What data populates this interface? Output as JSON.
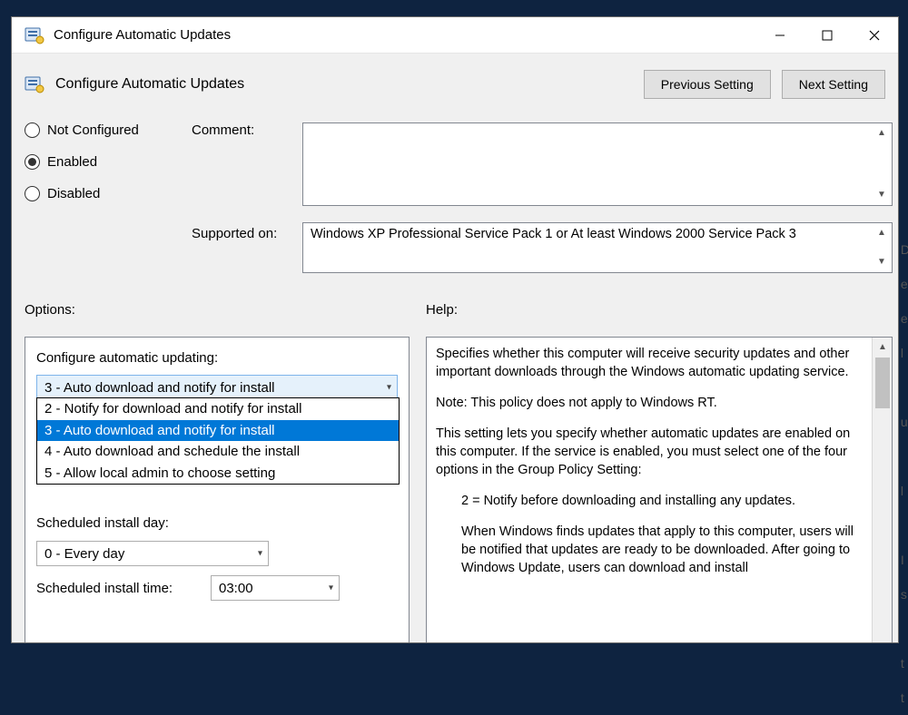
{
  "window": {
    "title": "Configure Automatic Updates",
    "header_title": "Configure Automatic Updates"
  },
  "nav": {
    "previous": "Previous Setting",
    "next": "Next Setting"
  },
  "state_radios": {
    "not_configured": "Not Configured",
    "enabled": "Enabled",
    "disabled": "Disabled",
    "selected": "enabled"
  },
  "labels": {
    "comment": "Comment:",
    "supported_on": "Supported on:",
    "options": "Options:",
    "help": "Help:"
  },
  "supported_on_text": "Windows XP Professional Service Pack 1 or At least Windows 2000 Service Pack 3",
  "options": {
    "configure_label": "Configure automatic updating:",
    "configure_value": "3 - Auto download and notify for install",
    "dropdown_items": [
      "2 - Notify for download and notify for install",
      "3 - Auto download and notify for install",
      "4 - Auto download and schedule the install",
      "5 - Allow local admin to choose setting"
    ],
    "dropdown_selected_index": 1,
    "scheduled_day_label": "Scheduled install day:",
    "scheduled_day_value": "0 - Every day",
    "scheduled_time_label": "Scheduled install time:",
    "scheduled_time_value": "03:00"
  },
  "help_text": {
    "p1": "Specifies whether this computer will receive security updates and other important downloads through the Windows automatic updating service.",
    "p2": "Note: This policy does not apply to Windows RT.",
    "p3": "This setting lets you specify whether automatic updates are enabled on this computer. If the service is enabled, you must select one of the four options in the Group Policy Setting:",
    "p4": "2 = Notify before downloading and installing any updates.",
    "p5": "When Windows finds updates that apply to this computer, users will be notified that updates are ready to be downloaded. After going to Windows Update, users can download and install"
  }
}
